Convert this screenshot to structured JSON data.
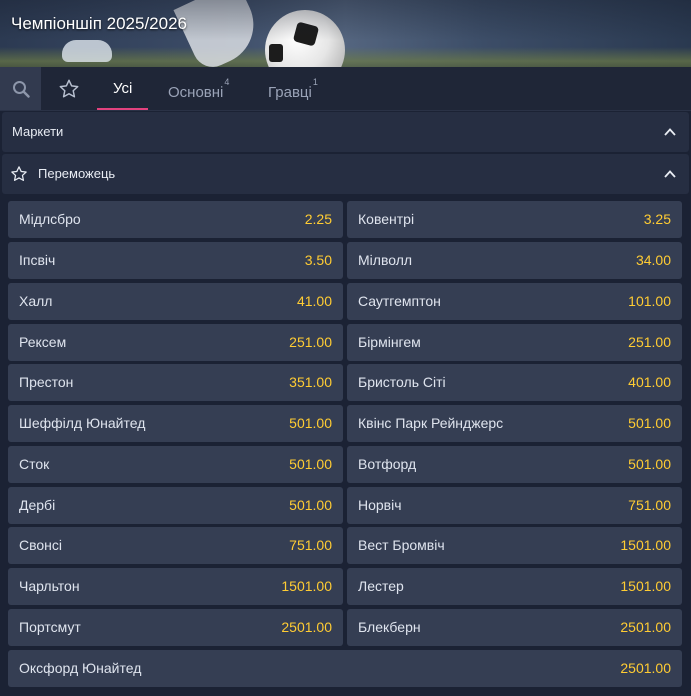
{
  "header": {
    "title": "Чемпіоншіп 2025/2026"
  },
  "tabs": [
    {
      "label": "Усі",
      "badge": ""
    },
    {
      "label": "Основні",
      "badge": "4"
    },
    {
      "label": "Гравці",
      "badge": "1"
    }
  ],
  "markets_section": {
    "label": "Маркети"
  },
  "winner_section": {
    "label": "Переможець"
  },
  "outcomes": [
    {
      "name": "Мідлсбро",
      "odd": "2.25"
    },
    {
      "name": "Ковентрі",
      "odd": "3.25"
    },
    {
      "name": "Іпсвіч",
      "odd": "3.50"
    },
    {
      "name": "Мілволл",
      "odd": "34.00"
    },
    {
      "name": "Халл",
      "odd": "41.00"
    },
    {
      "name": "Саутгемптон",
      "odd": "101.00"
    },
    {
      "name": "Рексем",
      "odd": "251.00"
    },
    {
      "name": "Бірмінгем",
      "odd": "251.00"
    },
    {
      "name": "Престон",
      "odd": "351.00"
    },
    {
      "name": "Бристоль Сіті",
      "odd": "401.00"
    },
    {
      "name": "Шеффілд Юнайтед",
      "odd": "501.00"
    },
    {
      "name": "Квінс Парк Рейнджерс",
      "odd": "501.00"
    },
    {
      "name": "Сток",
      "odd": "501.00"
    },
    {
      "name": "Вотфорд",
      "odd": "501.00"
    },
    {
      "name": "Дербі",
      "odd": "501.00"
    },
    {
      "name": "Норвіч",
      "odd": "751.00"
    },
    {
      "name": "Свонсі",
      "odd": "751.00"
    },
    {
      "name": "Вест Бромвіч",
      "odd": "1501.00"
    },
    {
      "name": "Чарльтон",
      "odd": "1501.00"
    },
    {
      "name": "Лестер",
      "odd": "1501.00"
    },
    {
      "name": "Портсмут",
      "odd": "2501.00"
    },
    {
      "name": "Блекберн",
      "odd": "2501.00"
    },
    {
      "name": "Оксфорд Юнайтед",
      "odd": "2501.00"
    }
  ],
  "colors": {
    "accent": "#e2427e",
    "odd": "#ffcc33",
    "cell": "#353e53",
    "background": "#1b2234"
  },
  "icons": [
    "search-icon",
    "star-icon",
    "chevron-up-icon"
  ]
}
